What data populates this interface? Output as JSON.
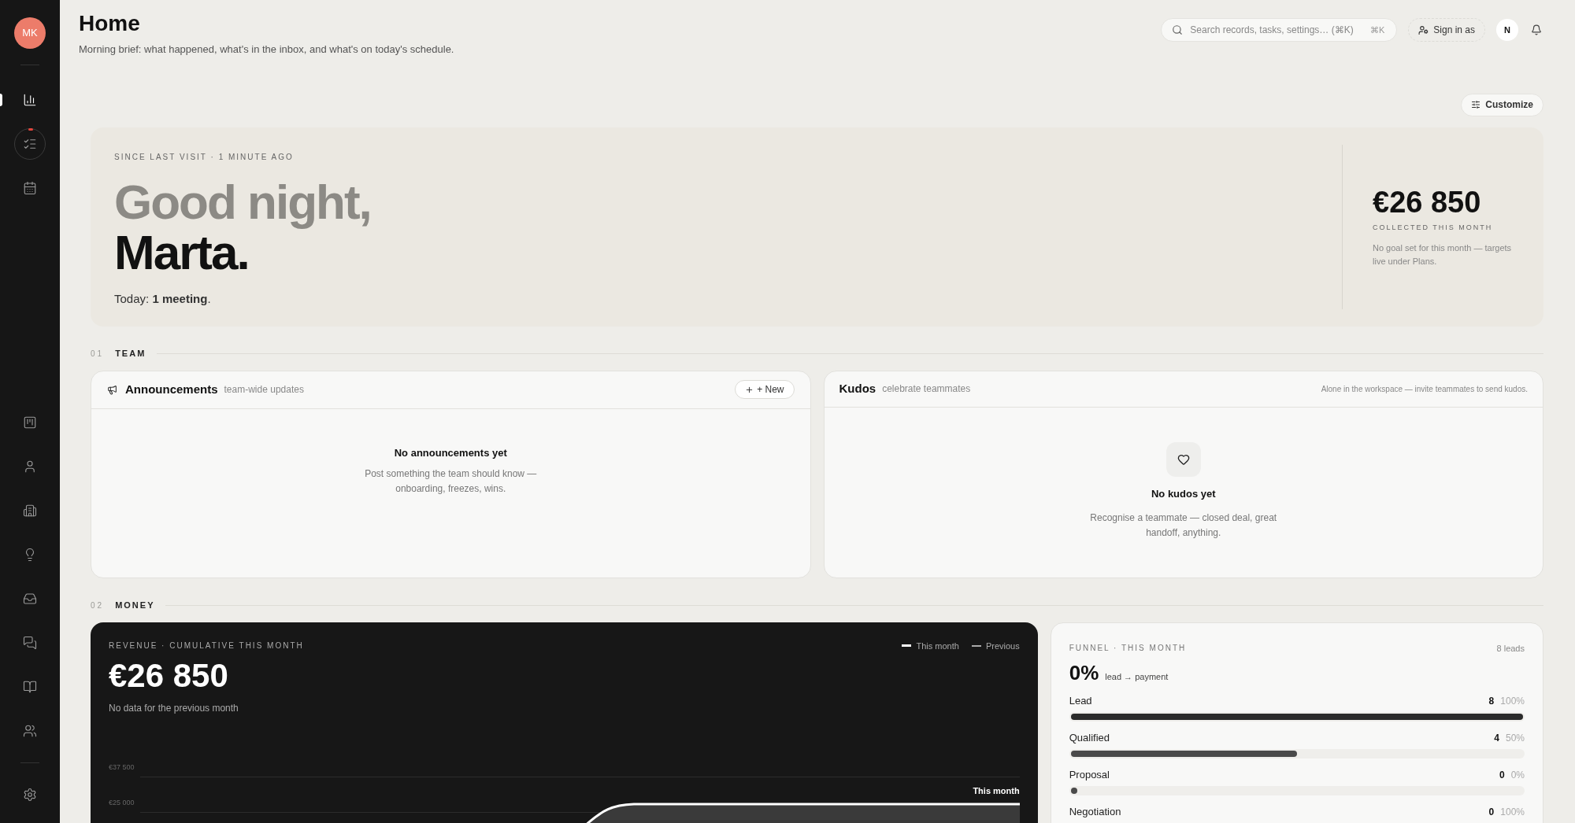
{
  "sidebar": {
    "avatar": "MK",
    "items": [
      {
        "selected": true,
        "dot": false
      },
      {
        "selected": false,
        "dot": true
      },
      {
        "selected": false,
        "dot": false
      }
    ],
    "lower_items": [
      {
        "selected": false
      },
      {
        "selected": false
      },
      {
        "selected": false
      },
      {
        "selected": false
      },
      {
        "selected": false
      },
      {
        "selected": false
      },
      {
        "selected": false
      },
      {
        "selected": false
      }
    ]
  },
  "header": {
    "title": "Home",
    "subtitle": "Morning brief: what happened, what's in the inbox, and what's on today's schedule.",
    "search": {
      "placeholder": "Search records, tasks, settings… (⌘K)",
      "shortcut": "⌘K"
    },
    "sign_in": "Sign in as",
    "user_initial": "N",
    "customize": "Customize"
  },
  "hero": {
    "eyebrow": "SINCE LAST VISIT · 1 MINUTE AGO",
    "greeting": "Good night,",
    "name": "Marta.",
    "today": "Today: **1 meeting**.",
    "amount": "€26 850",
    "amount_label": "COLLECTED THIS MONTH",
    "note": "No goal set for this month — targets live under Plans."
  },
  "team": {
    "number": "01",
    "label": "TEAM",
    "announcements": {
      "title": "Announcements",
      "subtitle": "team-wide updates",
      "new_button": "+ New",
      "empty_title": "No announcements yet",
      "empty_text": "Post something the team should know — onboarding, freezes, wins."
    },
    "kudos": {
      "title": "Kudos",
      "subtitle": "celebrate teammates",
      "hint": "Alone in the workspace — invite teammates to send kudos.",
      "empty_title": "No kudos yet",
      "empty_text": "Recognise a teammate — closed deal, great handoff, anything."
    }
  },
  "money": {
    "number": "02",
    "label": "MONEY",
    "revenue": {
      "eyebrow": "REVENUE · CUMULATIVE THIS MONTH",
      "legend": [
        {
          "label": "This month",
          "kind": "solid"
        },
        {
          "label": "Previous",
          "kind": "dashed"
        }
      ],
      "amount": "€26 850",
      "note": "No data for the previous month",
      "ticks": [
        "€37 500",
        "€25 000"
      ],
      "line_label": "This month"
    },
    "funnel": {
      "eyebrow": "FUNNEL · THIS MONTH",
      "count": "8 leads",
      "rate": "0%",
      "rate_label": "lead → payment",
      "stages": [
        {
          "name": "Lead",
          "count": "8",
          "percent": "100%",
          "level": 1
        },
        {
          "name": "Qualified",
          "count": "4",
          "percent": "50%",
          "level": 0.5
        },
        {
          "name": "Proposal",
          "count": "0",
          "percent": "0%",
          "level": 0
        },
        {
          "name": "Negotiation",
          "count": "0",
          "percent": "100%"
        }
      ]
    }
  }
}
